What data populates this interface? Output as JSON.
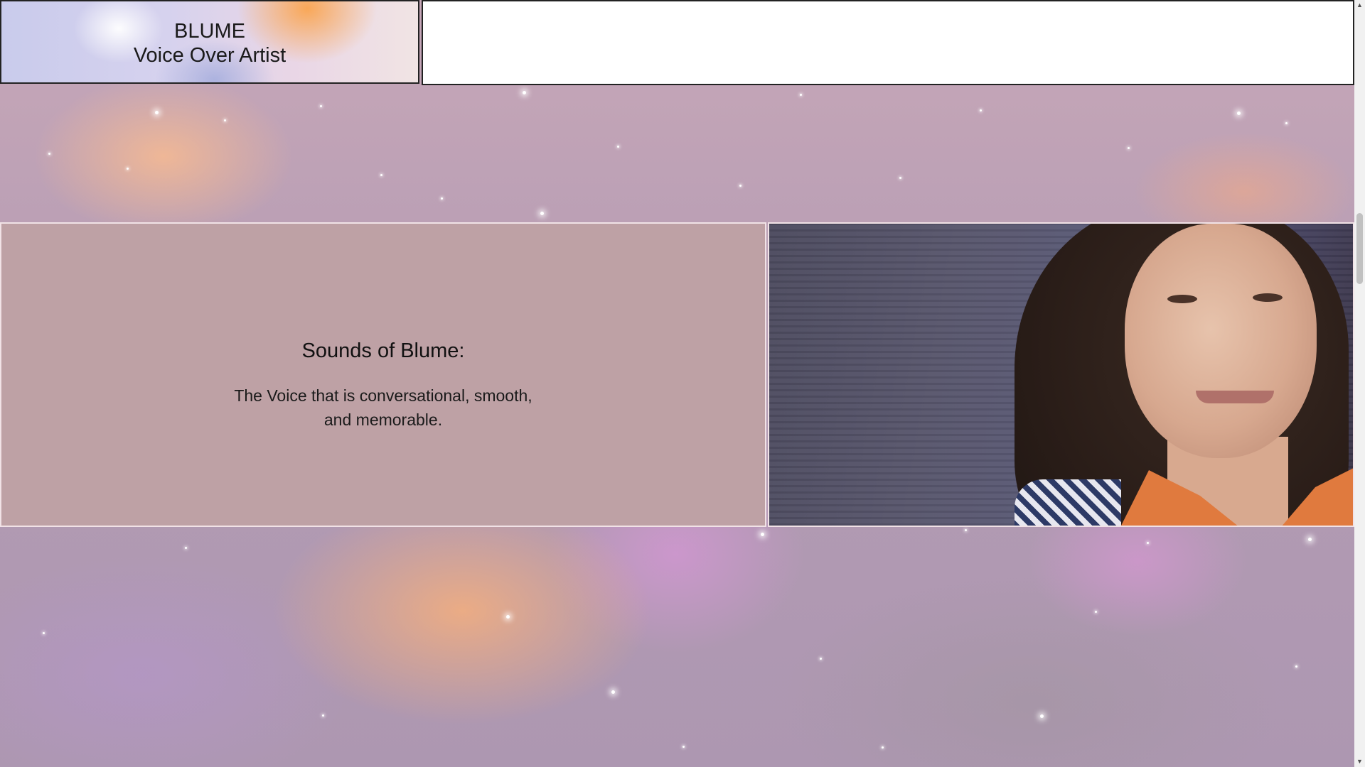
{
  "header": {
    "logo_line1": "BLUME",
    "logo_line2": "Voice Over Artist"
  },
  "hero": {
    "title": "Sounds of Blume:",
    "subtitle": "The Voice that is conversational, smooth, and memorable."
  },
  "colors": {
    "hero_box_bg": "#bea1a5",
    "header_right_bg": "#ffffff",
    "border": "#222222"
  },
  "icons": {
    "scroll_up": "▲",
    "scroll_down": "▼"
  }
}
